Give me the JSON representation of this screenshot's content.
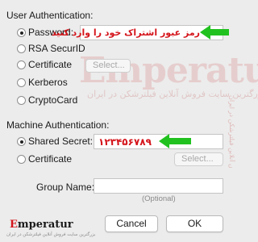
{
  "user_auth": {
    "title": "User Authentication:",
    "options": [
      {
        "label": "Password:",
        "selected": true
      },
      {
        "label": "RSA SecurID",
        "selected": false
      },
      {
        "label": "Certificate",
        "selected": false
      },
      {
        "label": "Kerberos",
        "selected": false
      },
      {
        "label": "CryptoCard",
        "selected": false
      }
    ],
    "password_value": "رمز عبور اشتراک خود را وارد کنید",
    "certificate_select_label": "Select..."
  },
  "machine_auth": {
    "title": "Machine Authentication:",
    "options": [
      {
        "label": "Shared Secret:",
        "selected": true
      },
      {
        "label": "Certificate",
        "selected": false
      }
    ],
    "shared_secret_value": "۱۲۳۴۵۶۷۸۹",
    "certificate_select_label": "Select..."
  },
  "group": {
    "label": "Group Name:",
    "value": "",
    "hint": "(Optional)"
  },
  "buttons": {
    "cancel": "Cancel",
    "ok": "OK"
  },
  "watermark": {
    "brand": "Emperatur",
    "subtitle": "بزرگترین سایت فروش آنلاین فیلترشکن در ایران",
    "side_text": "بزرگترین سایت فروش آنلاین فیلترشکن در ایران",
    "logo_prefix": "E",
    "logo_rest": "mperatur",
    "logo_tagline": "بزرگترین سایت فروش آنلاین فیلترشکن در ایران"
  },
  "colors": {
    "accent_red": "#d4141a",
    "arrow_green": "#21c21f",
    "background": "#ececec"
  },
  "icons": {
    "arrow": "arrow-left-icon"
  }
}
